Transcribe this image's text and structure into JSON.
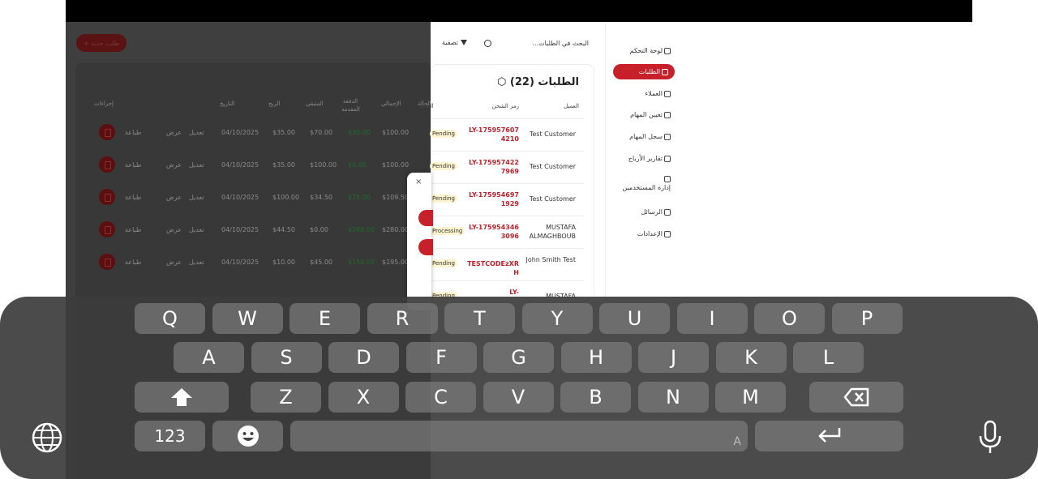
{
  "app": {
    "add_button": "+ طلب جديد",
    "search_placeholder": "البحث في الطلبات...",
    "filter_label": "تصفية",
    "orders_title": "الطلبات (22)",
    "table_headers": {
      "customer": "العميل",
      "shipping_code": "رمز الشحن",
      "status": "الحالة",
      "total": "الإجمالي",
      "paid": "الدفعة المقدمة",
      "remaining": "المتبقي",
      "profit": "الربح",
      "date": "التاريخ",
      "actions": "إجراءات"
    },
    "orders": [
      {
        "customer": "Test Customer",
        "code": "LY-1759576074210",
        "status": "Pending",
        "total": "$100.00",
        "paid": "$30.00",
        "remaining": "$70.00",
        "profit": "$35.00",
        "date": "04/10/2025"
      },
      {
        "customer": "Test Customer",
        "code": "LY-1759574227969",
        "status": "Pending",
        "total": "$100.00",
        "paid": "$0.00",
        "remaining": "$100.00",
        "profit": "$35.00",
        "date": "04/10/2025"
      },
      {
        "customer": "Test Customer",
        "code": "LY-1759546971929",
        "status": "Pending",
        "total": "$109.50",
        "paid": "$75.00",
        "remaining": "$34.50",
        "profit": "$100.00",
        "date": "04/10/2025"
      },
      {
        "customer": "MUSTAFA ALMAGHBOUB",
        "code": "LY-1759543463096",
        "status": "Processing",
        "total": "$280.00",
        "paid": "$280.00",
        "remaining": "$0.00",
        "profit": "$44.50",
        "date": "04/10/2025"
      },
      {
        "customer": "John Smith Test",
        "code": "TESTCODEzXRH",
        "status": "Pending",
        "total": "$195.00",
        "paid": "$150.00",
        "remaining": "$45.00",
        "profit": "$10.00",
        "date": "04/10/2025"
      },
      {
        "customer": "MUSTAFA",
        "code": "LY-",
        "status": "Pending",
        "total": "",
        "paid": "",
        "remaining": "",
        "profit": "",
        "date": ""
      }
    ],
    "row_actions": {
      "print": "طباعة",
      "view": "عرض",
      "edit": "تعديل"
    },
    "sidebar": [
      {
        "label": "لوحة التحكم",
        "icon": "dashboard-icon"
      },
      {
        "label": "الطلبات",
        "icon": "box-icon",
        "active": true
      },
      {
        "label": "العملاء",
        "icon": "users-icon"
      },
      {
        "label": "تعيين المهام",
        "icon": "tasks-icon"
      },
      {
        "label": "سجل المهام",
        "icon": "history-icon"
      },
      {
        "label": "تقارير الأرباح",
        "icon": "chart-icon"
      },
      {
        "label": "إدارة المستخدمين",
        "icon": "user-admin-icon"
      },
      {
        "label": "الرسائل",
        "icon": "message-icon"
      },
      {
        "label": "الإعدادات",
        "icon": "settings-icon"
      }
    ]
  },
  "keyboard": {
    "row1": [
      "Q",
      "W",
      "E",
      "R",
      "T",
      "Y",
      "U",
      "I",
      "O",
      "P"
    ],
    "row2": [
      "A",
      "S",
      "D",
      "F",
      "G",
      "H",
      "J",
      "K",
      "L"
    ],
    "row3": [
      "Z",
      "X",
      "C",
      "V",
      "B",
      "N",
      "M"
    ],
    "numbers_key": "123"
  },
  "colors": {
    "accent": "#c8202a",
    "keyboard_bg": "#3c3c3c",
    "key_bg": "#787878"
  }
}
